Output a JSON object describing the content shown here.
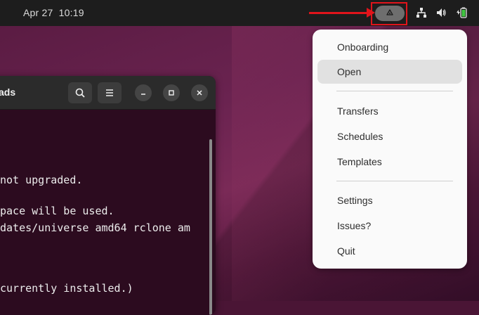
{
  "topbar": {
    "date": "Apr 27",
    "time": "10:19"
  },
  "terminal": {
    "title_fragment": "ads",
    "lines": [
      "not upgraded.",
      "",
      "pace will be used.",
      "dates/universe amd64 rclone am",
      "",
      "",
      "currently installed.)"
    ]
  },
  "menu": {
    "items": [
      {
        "label": "Onboarding"
      },
      {
        "label": "Open"
      },
      {
        "label": "Transfers"
      },
      {
        "label": "Schedules"
      },
      {
        "label": "Templates"
      },
      {
        "label": "Settings"
      },
      {
        "label": "Issues?"
      },
      {
        "label": "Quit"
      }
    ]
  },
  "colors": {
    "annotation": "#e1141b",
    "menu_bg": "#fafafa",
    "topbar_bg": "#1d1d1d"
  }
}
